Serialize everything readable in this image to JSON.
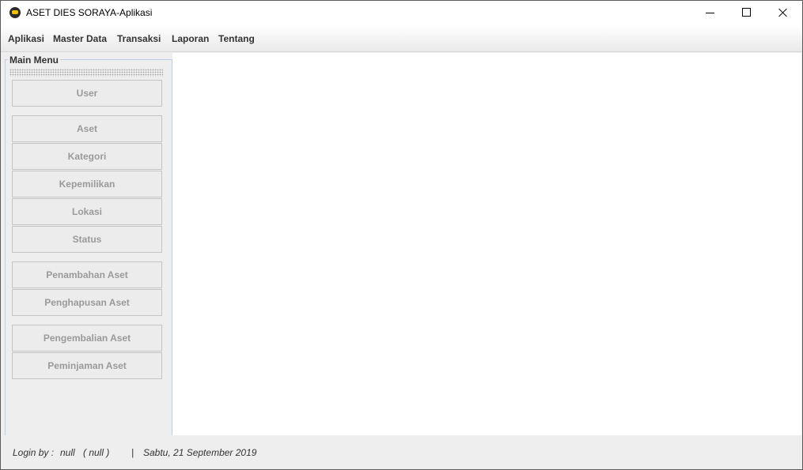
{
  "window": {
    "title": "ASET DIES SORAYA-Aplikasi",
    "app_icon": "app-logo-icon",
    "controls": [
      "minimize-icon",
      "maximize-icon",
      "close-icon"
    ]
  },
  "menubar": {
    "items": [
      "Aplikasi",
      "Master Data",
      "Transaksi",
      "Laporan",
      "Tentang"
    ]
  },
  "sidebar": {
    "title": "Main Menu",
    "buttons": [
      "User",
      "Aset",
      "Kategori",
      "Kepemilikan",
      "Lokasi",
      "Status",
      "Penambahan Aset",
      "Penghapusan Aset",
      "Pengembalian Aset",
      "Peminjaman Aset"
    ]
  },
  "status": {
    "login_label": "Login by :",
    "login_user": "null",
    "login_role": "( null )",
    "separator": "|",
    "date": "Sabtu, 21 September 2019"
  },
  "colors": {
    "window_bg": "#eeeeee",
    "content_bg": "#ffffff",
    "sidebar_border": "#b8cfe5",
    "disabled_text": "#9a9a9a"
  }
}
